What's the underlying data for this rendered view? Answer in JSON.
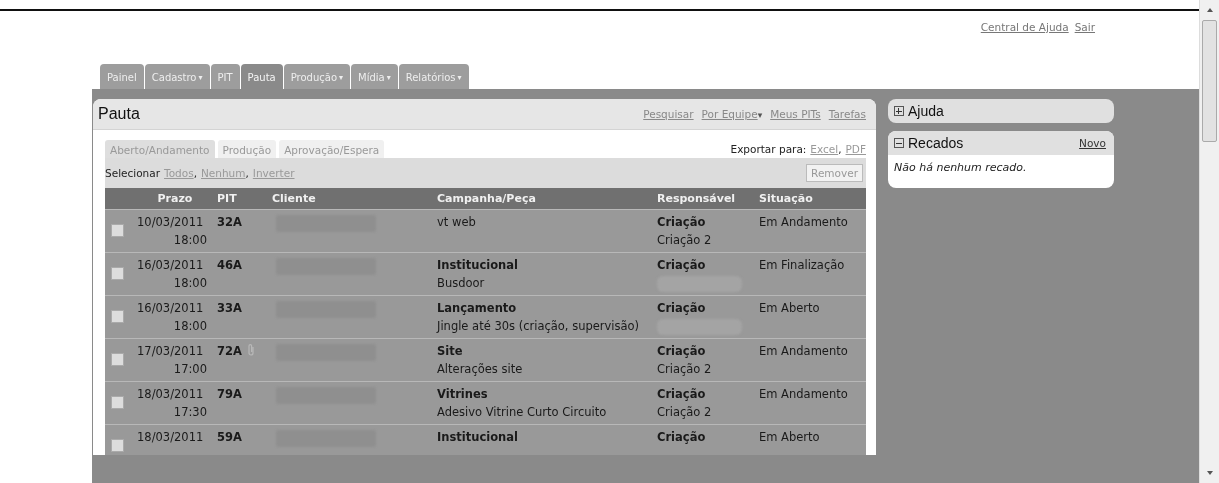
{
  "top_links": [
    {
      "label": "Central de Ajuda"
    },
    {
      "label": "Sair"
    }
  ],
  "nav_tabs": [
    {
      "label": "Painel",
      "selected": false
    },
    {
      "label": "Cadastro",
      "caret": "▾",
      "selected": false
    },
    {
      "label": "PIT",
      "selected": false
    },
    {
      "label": "Pauta",
      "selected": true
    },
    {
      "label": "Produção",
      "caret": "▾",
      "selected": false
    },
    {
      "label": "Mídia",
      "caret": "▾",
      "selected": false
    },
    {
      "label": "Relatórios",
      "caret": "▾",
      "selected": false
    }
  ],
  "panel": {
    "title": "Pauta",
    "links": [
      {
        "label": "Pesquisar"
      },
      {
        "label": "Por Equipe",
        "caret": "▾"
      },
      {
        "label": "Meus PITs"
      },
      {
        "label": "Tarefas"
      }
    ],
    "subtabs": [
      {
        "label": "Aberto/Andamento",
        "selected": true
      },
      {
        "label": "Produção",
        "selected": false
      },
      {
        "label": "Aprovação/Espera",
        "selected": false
      }
    ],
    "export_label": "Exportar para:",
    "export_links": [
      {
        "label": "Excel",
        "separator": ","
      },
      {
        "label": "PDF"
      }
    ],
    "select_label": "Selecionar",
    "select_links": [
      {
        "label": "Todos",
        "separator": ","
      },
      {
        "label": "Nenhum",
        "separator": ","
      },
      {
        "label": "Inverter"
      }
    ],
    "remove_button": "Remover",
    "columns": [
      "Prazo",
      "PIT",
      "Cliente",
      "Campanha/Peça",
      "Responsável",
      "Situação"
    ],
    "rows": [
      {
        "checked": false,
        "date": "10/03/2011",
        "time": "18:00",
        "pit": "32A",
        "attachment": false,
        "client_redacted": true,
        "piece": "vt web",
        "team": "Criação",
        "member": "Criação 2",
        "status": "Em Andamento"
      },
      {
        "checked": false,
        "date": "16/03/2011",
        "time": "18:00",
        "pit": "46A",
        "attachment": false,
        "client_redacted": true,
        "campaign": "Institucional",
        "piece": "Busdoor",
        "team": "Criação",
        "member_redacted": true,
        "status": "Em Finalização"
      },
      {
        "checked": false,
        "date": "16/03/2011",
        "time": "18:00",
        "pit": "33A",
        "attachment": false,
        "client_redacted": true,
        "campaign": "Lançamento",
        "piece": "Jingle até 30s (criação, supervisão)",
        "team": "Criação",
        "member_redacted": true,
        "status": "Em Aberto"
      },
      {
        "checked": false,
        "date": "17/03/2011",
        "time": "17:00",
        "pit": "72A",
        "attachment": true,
        "client_redacted": true,
        "campaign": "Site",
        "piece": "Alterações site",
        "team": "Criação",
        "member": "Criação 2",
        "status": "Em Andamento"
      },
      {
        "checked": false,
        "date": "18/03/2011",
        "time": "17:30",
        "pit": "79A",
        "attachment": false,
        "client_redacted": true,
        "campaign": "Vitrines",
        "piece": "Adesivo Vitrine Curto Circuito",
        "team": "Criação",
        "member": "Criação 2",
        "status": "Em Andamento"
      },
      {
        "checked": false,
        "date": "18/03/2011",
        "pit": "59A",
        "attachment": false,
        "client_redacted": true,
        "campaign": "Institucional",
        "team": "Criação",
        "status": "Em Aberto"
      }
    ]
  },
  "sidebar": [
    {
      "title": "Ajuda",
      "expanded": false
    },
    {
      "title": "Recados",
      "expanded": true,
      "action": "Novo",
      "message": "Não há nenhum recado."
    }
  ]
}
